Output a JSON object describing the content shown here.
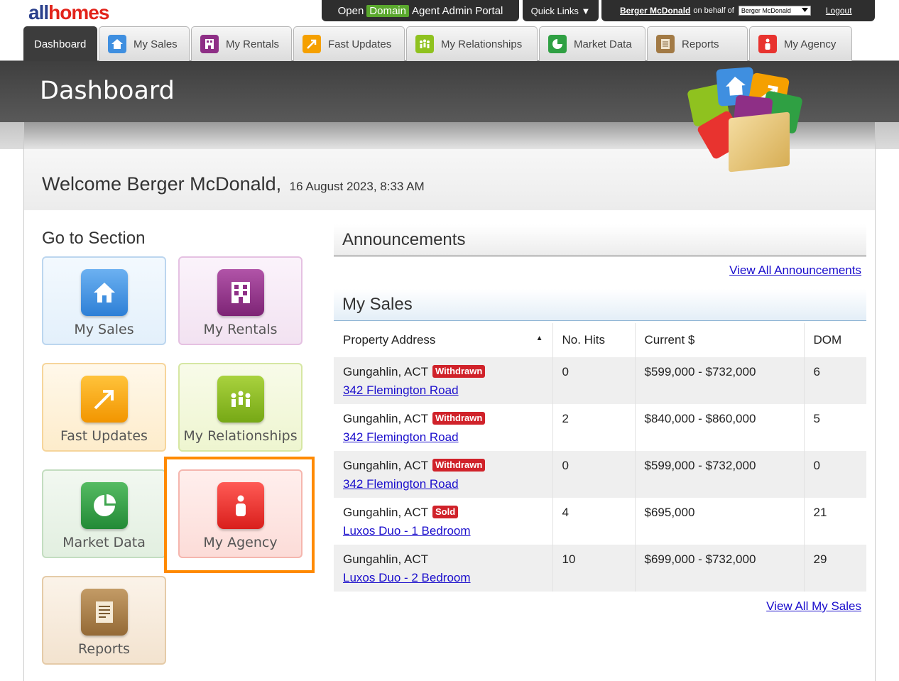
{
  "logo": {
    "part1": "all",
    "part2": "homes"
  },
  "topbar": {
    "portal_open": "Open",
    "portal_brand": "Domain",
    "portal_rest": "Agent Admin Portal",
    "quick_links": "Quick Links ▼",
    "user_name": "Berger McDonald",
    "on_behalf": "on behalf of",
    "behalf_select": "Berger McDonald",
    "logout": "Logout"
  },
  "tabs": [
    {
      "label": "Dashboard",
      "icon": "none",
      "color": ""
    },
    {
      "label": "My Sales",
      "icon": "house-icon",
      "color": "#3f8fe0"
    },
    {
      "label": "My Rentals",
      "icon": "building-icon",
      "color": "#8e2f86"
    },
    {
      "label": "Fast Updates",
      "icon": "arrow-icon",
      "color": "#f5a000"
    },
    {
      "label": "My Relationships",
      "icon": "people-icon",
      "color": "#8fc21f"
    },
    {
      "label": "Market Data",
      "icon": "pie-icon",
      "color": "#2fa043"
    },
    {
      "label": "Reports",
      "icon": "document-icon",
      "color": "#a27a45"
    },
    {
      "label": "My Agency",
      "icon": "agent-icon",
      "color": "#e8332f"
    }
  ],
  "page_title": "Dashboard",
  "welcome": {
    "text": "Welcome Berger McDonald,",
    "date": "16 August 2023, 8:33 AM"
  },
  "go_to_section": {
    "title": "Go to Section",
    "tiles": [
      {
        "label": "My Sales",
        "icon": "house-icon"
      },
      {
        "label": "My Rentals",
        "icon": "building-icon"
      },
      {
        "label": "Fast Updates",
        "icon": "arrow-icon"
      },
      {
        "label": "My Relationships",
        "icon": "people-icon"
      },
      {
        "label": "Market Data",
        "icon": "pie-icon"
      },
      {
        "label": "My Agency",
        "icon": "agent-icon"
      },
      {
        "label": "Reports",
        "icon": "document-icon"
      }
    ]
  },
  "announcements": {
    "title": "Announcements",
    "view_all": "View All Announcements"
  },
  "my_sales": {
    "title": "My Sales",
    "columns": [
      "Property Address",
      "No. Hits",
      "Current $",
      "DOM"
    ],
    "rows": [
      {
        "suburb": "Gungahlin, ACT",
        "badge": "Withdrawn",
        "address": "342 Flemington Road",
        "hits": "0",
        "price": "$599,000 - $732,000",
        "dom": "6"
      },
      {
        "suburb": "Gungahlin, ACT",
        "badge": "Withdrawn",
        "address": "342 Flemington Road",
        "hits": "2",
        "price": "$840,000 - $860,000",
        "dom": "5"
      },
      {
        "suburb": "Gungahlin, ACT",
        "badge": "Withdrawn",
        "address": "342 Flemington Road",
        "hits": "0",
        "price": "$599,000 - $732,000",
        "dom": "0"
      },
      {
        "suburb": "Gungahlin, ACT",
        "badge": "Sold",
        "address": "Luxos Duo - 1 Bedroom",
        "hits": "4",
        "price": "$695,000",
        "dom": "21"
      },
      {
        "suburb": "Gungahlin, ACT",
        "badge": "",
        "address": "Luxos Duo - 2 Bedroom",
        "hits": "10",
        "price": "$699,000 - $732,000",
        "dom": "29"
      }
    ],
    "view_all": "View All My Sales"
  },
  "colors": {
    "accent_green": "#5aa82d",
    "badge_red": "#d0222a",
    "highlight_orange": "#ff8a00",
    "link_blue": "#1a0dcc"
  }
}
